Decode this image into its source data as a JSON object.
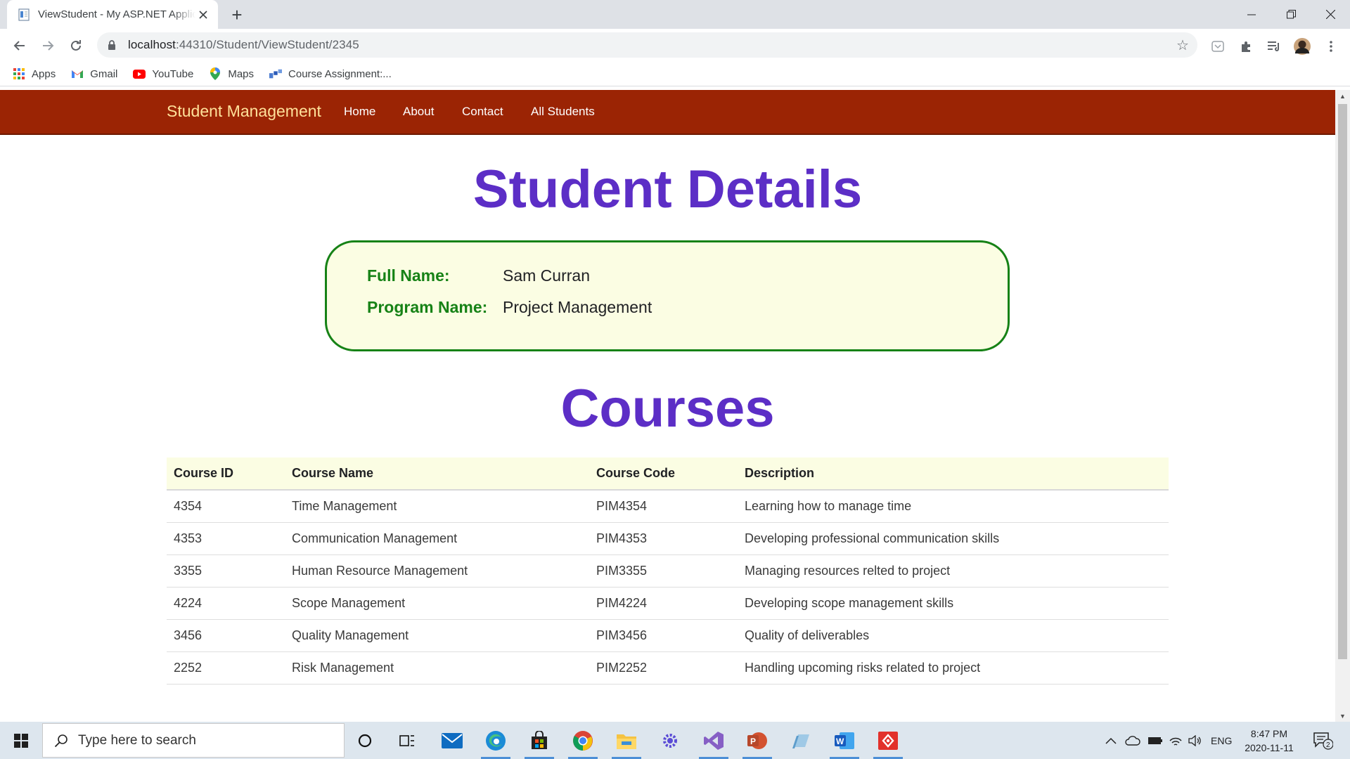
{
  "browser": {
    "tab_title": "ViewStudent - My ASP.NET Application",
    "new_tab_symbol": "+",
    "url_host": "localhost",
    "url_path": ":44310/Student/ViewStudent/2345",
    "bookmarks": [
      {
        "label": "Apps",
        "icon": "apps-grid-icon"
      },
      {
        "label": "Gmail",
        "icon": "gmail-icon"
      },
      {
        "label": "YouTube",
        "icon": "youtube-icon"
      },
      {
        "label": "Maps",
        "icon": "maps-icon"
      },
      {
        "label": "Course Assignment:...",
        "icon": "course-assignment-icon"
      }
    ]
  },
  "site": {
    "brand": "Student Management",
    "nav": [
      {
        "label": "Home"
      },
      {
        "label": "About"
      },
      {
        "label": "Contact"
      },
      {
        "label": "All Students"
      }
    ],
    "colors": {
      "navbar": "#9b2404",
      "brand": "#ffe19a",
      "heading": "#5c2ec6",
      "card_border": "#168216",
      "card_bg": "#fbfde3"
    }
  },
  "details": {
    "heading": "Student Details",
    "full_name_label": "Full Name:",
    "full_name": "Sam Curran",
    "program_label": "Program Name:",
    "program": "Project Management"
  },
  "courses": {
    "heading": "Courses",
    "columns": [
      "Course ID",
      "Course Name",
      "Course Code",
      "Description"
    ],
    "rows": [
      [
        "4354",
        "Time Management",
        "PIM4354",
        "Learning how to manage time"
      ],
      [
        "4353",
        "Communication Management",
        "PIM4353",
        "Developing professional communication skills"
      ],
      [
        "3355",
        "Human Resource Management",
        "PIM3355",
        "Managing resources relted to project"
      ],
      [
        "4224",
        "Scope Management",
        "PIM4224",
        "Developing scope management skills"
      ],
      [
        "3456",
        "Quality Management",
        "PIM3456",
        "Quality of deliverables"
      ],
      [
        "2252",
        "Risk Management",
        "PIM2252",
        "Handling upcoming risks related to project"
      ]
    ]
  },
  "taskbar": {
    "search_placeholder": "Type here to search",
    "language": "ENG",
    "time": "8:47 PM",
    "date": "2020-11-11",
    "notification_count": "2"
  }
}
